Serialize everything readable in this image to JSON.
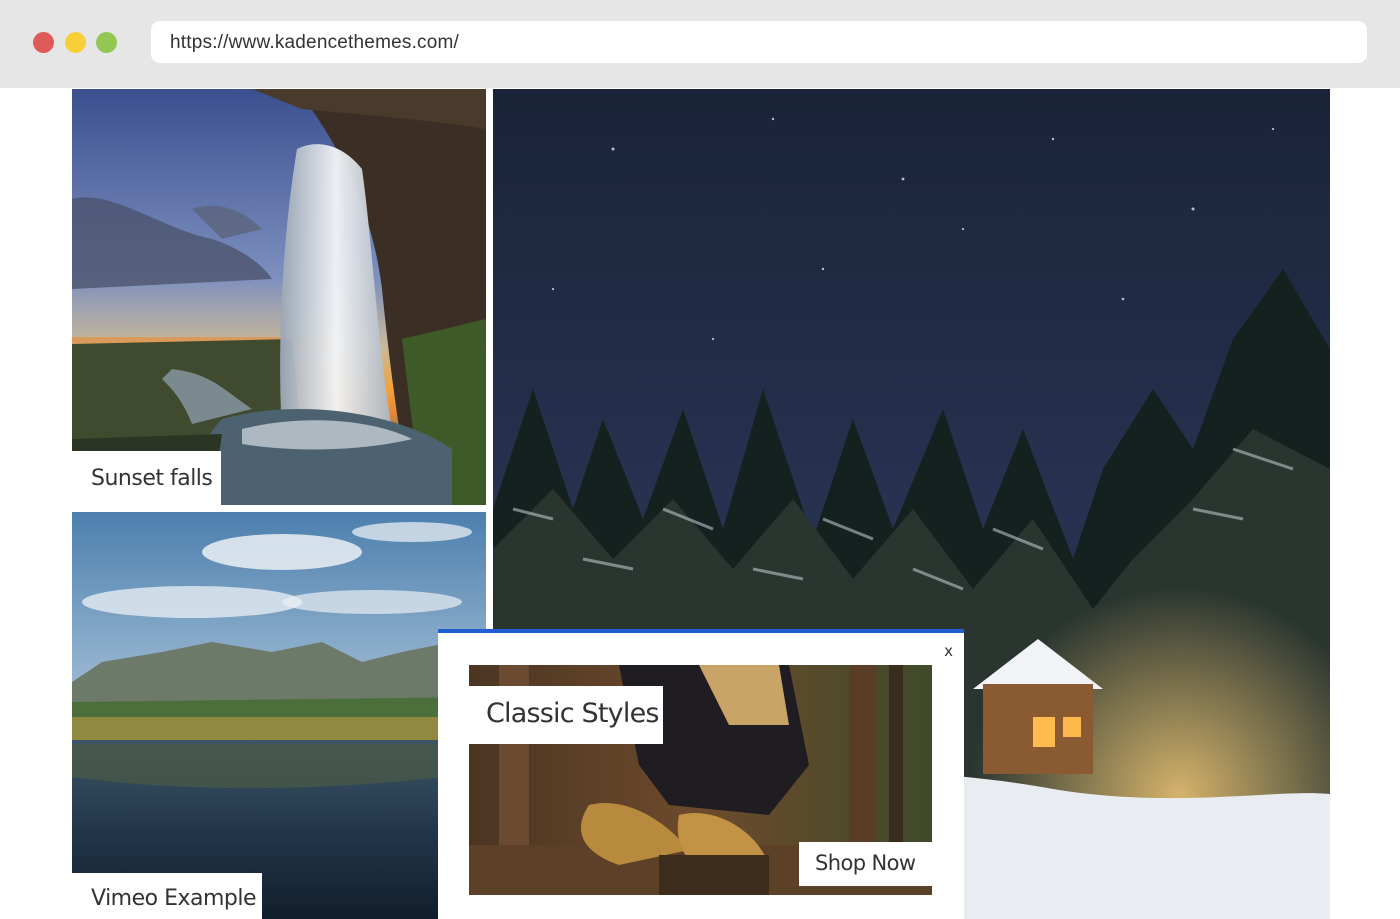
{
  "browser": {
    "url": "https://www.kadencethemes.com/"
  },
  "gallery": {
    "items": [
      {
        "caption": "Sunset falls"
      },
      {
        "caption": "Vimeo Example"
      }
    ]
  },
  "popup": {
    "close_label": "x",
    "title": "Classic Styles",
    "cta_label": "Shop Now",
    "accent_color": "#1f5fd3"
  },
  "colors": {
    "traffic_red": "#e05a5a",
    "traffic_yellow": "#f7cf3b",
    "traffic_green": "#93c752"
  }
}
